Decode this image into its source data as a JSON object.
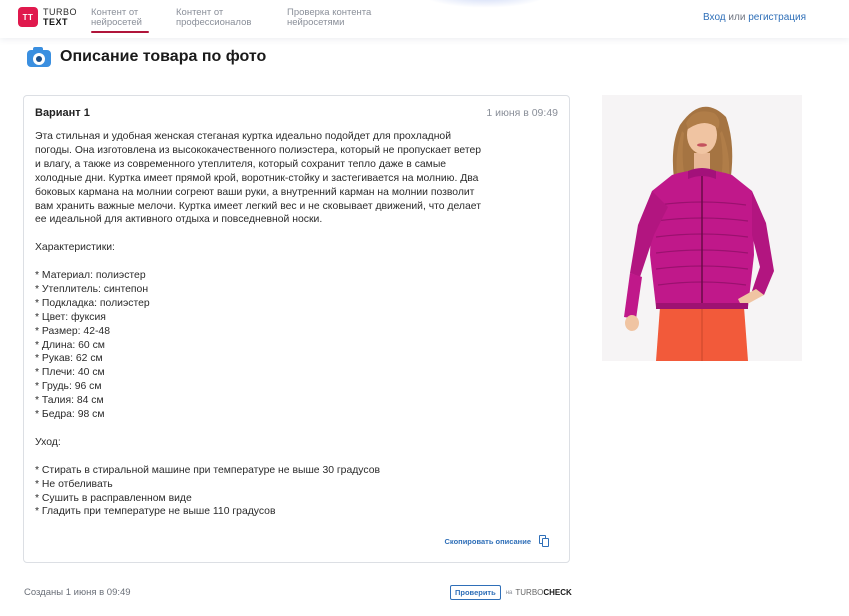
{
  "header": {
    "logo": {
      "badge": "TT",
      "line1": "TURBO",
      "line2": "TEXT"
    },
    "nav": [
      {
        "line1": "Контент от",
        "line2": "нейросетей"
      },
      {
        "line1": "Контент от",
        "line2": "профессионалов"
      },
      {
        "line1": "Проверка контента",
        "line2": "нейросетями"
      }
    ],
    "auth": {
      "login": "Вход",
      "or": "или",
      "register": "регистрация"
    }
  },
  "page": {
    "title": "Описание товара по фото",
    "title_icon": "camera-icon"
  },
  "card": {
    "title": "Вариант 1",
    "date": "1 июня в 09:49",
    "paragraph": [
      "Эта стильная и удобная женская стеганая куртка идеально подойдет для прохладной",
      "погоды. Она изготовлена из высококачественного полиэстера, который не пропускает ветер",
      "и влагу, а также из современного утеплителя, который сохранит тепло даже в самые",
      "холодные дни. Куртка имеет прямой крой, воротник-стойку и застегивается на молнию. Два",
      "боковых кармана на молнии согреют ваши руки, а внутренний карман на молнии позволит",
      "вам хранить важные мелочи. Куртка имеет легкий вес и не сковывает движений, что делает",
      "ее идеальной для активного отдыха и повседневной носки."
    ],
    "specs_heading": "Характеристики:",
    "specs": [
      "* Материал: полиэстер",
      "* Утеплитель: синтепон",
      "* Подкладка: полиэстер",
      "* Цвет: фуксия",
      "* Размер: 42-48",
      "* Длина: 60 см",
      "* Рукав: 62 см",
      "* Плечи: 40 см",
      "* Грудь: 96 см",
      "* Талия: 84 см",
      "* Бедра: 98 см"
    ],
    "care_heading": "Уход:",
    "care": [
      "* Стирать в стиральной машине при температуре не выше 30 градусов",
      "* Не отбеливать",
      "* Сушить в расправленном виде",
      "* Гладить при температуре не выше 110 градусов"
    ],
    "copy_label": "Скопировать описание",
    "copy_icon": "copy-icon"
  },
  "footer": {
    "created": "Созданы 1 июня в 09:49",
    "check_button": "Проверить",
    "check_on": "на",
    "brand_part1": "TURBO",
    "brand_part2": "CHECK"
  },
  "colors": {
    "accent_red": "#e0194d",
    "link_blue": "#2f6fb8",
    "jacket_fuchsia": "#c0188a",
    "pants_coral": "#f25a3a"
  }
}
